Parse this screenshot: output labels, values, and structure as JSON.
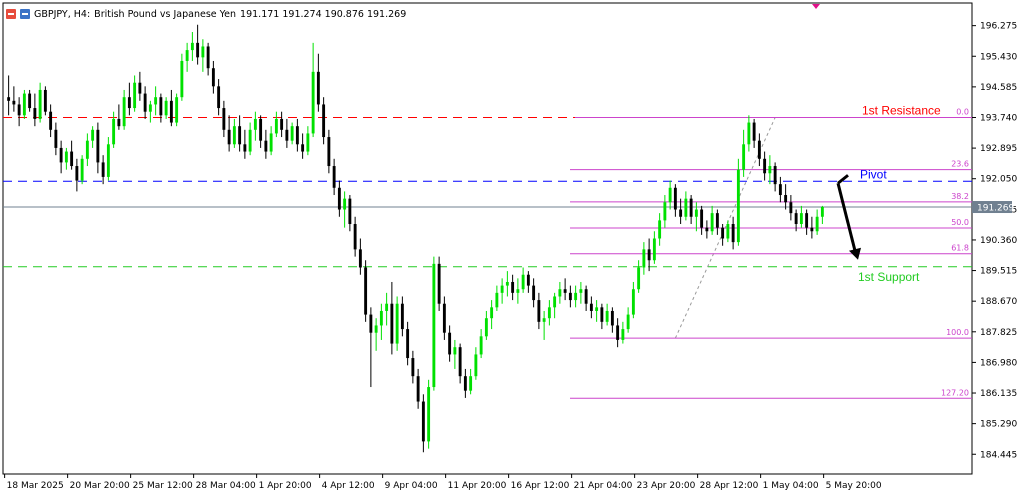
{
  "header": {
    "symbol_timeframe": "GBPJPY, H4:",
    "description": "British Pound vs Japanese Yen",
    "ohlc": "191.171 191.274 190.876 191.269",
    "icons": [
      "chart-properties-icon",
      "indicator-list-icon"
    ]
  },
  "colors": {
    "bull": "#00e000",
    "bear": "#000000",
    "resistance": "#ff0000",
    "pivot": "#0000ff",
    "support": "#22cc22",
    "fib": "#cc44cc",
    "price_line": "#708090",
    "price_badge_bg": "#708090",
    "marker": "#e0128a"
  },
  "chart_data": {
    "type": "candlestick",
    "symbol": "GBPJPY",
    "timeframe": "H4",
    "current_price": "191.269",
    "ylim": [
      183.9,
      196.9
    ],
    "y_ticks": [
      "196.275",
      "195.430",
      "194.585",
      "193.740",
      "192.895",
      "192.050",
      "191.205",
      "190.360",
      "189.515",
      "188.670",
      "187.825",
      "186.980",
      "186.135",
      "185.290",
      "184.445"
    ],
    "x_ticks": [
      "18 Mar 2025",
      "20 Mar 20:00",
      "25 Mar 12:00",
      "28 Mar 04:00",
      "1 Apr 20:00",
      "4 Apr 12:00",
      "9 Apr 04:00",
      "11 Apr 20:00",
      "16 Apr 12:00",
      "21 Apr 04:00",
      "23 Apr 20:00",
      "28 Apr 12:00",
      "1 May 04:00",
      "5 May 20:00"
    ],
    "bar_count": 162,
    "levels": [
      {
        "label": "1st Resistance",
        "value": 193.74,
        "color": "#ff0000"
      },
      {
        "label": "Pivot",
        "value": 191.98,
        "color": "#0000ff"
      },
      {
        "label": "1st Support",
        "value": 189.62,
        "color": "#22cc22"
      }
    ],
    "fibonacci": {
      "high": 193.74,
      "low": 187.65,
      "from_bar": 127,
      "to_bar": 146,
      "levels": [
        {
          "label": "0.0",
          "value": 193.74
        },
        {
          "label": "23.6",
          "value": 192.3
        },
        {
          "label": "38.2",
          "value": 191.41
        },
        {
          "label": "50.0",
          "value": 190.69
        },
        {
          "label": "61.8",
          "value": 189.98
        },
        {
          "label": "100.0",
          "value": 187.65
        },
        {
          "label": "127.20",
          "value": 185.99
        }
      ]
    },
    "candles": [
      [
        194.3,
        194.9,
        193.8,
        194.2
      ],
      [
        194.2,
        194.6,
        193.9,
        194.1
      ],
      [
        194.1,
        194.3,
        193.5,
        193.8
      ],
      [
        193.8,
        194.5,
        193.7,
        194.4
      ],
      [
        194.4,
        194.5,
        193.9,
        194.0
      ],
      [
        194.0,
        194.4,
        193.5,
        193.7
      ],
      [
        193.7,
        194.7,
        193.6,
        194.5
      ],
      [
        194.5,
        194.6,
        193.8,
        193.9
      ],
      [
        193.9,
        194.1,
        193.2,
        193.4
      ],
      [
        193.4,
        193.6,
        192.7,
        192.9
      ],
      [
        192.9,
        193.1,
        192.2,
        192.5
      ],
      [
        192.5,
        192.9,
        192.3,
        192.8
      ],
      [
        192.8,
        193.1,
        192.3,
        192.4
      ],
      [
        192.4,
        192.6,
        191.7,
        192.0
      ],
      [
        192.0,
        192.7,
        191.9,
        192.6
      ],
      [
        192.6,
        193.3,
        192.4,
        193.1
      ],
      [
        193.1,
        193.5,
        192.9,
        193.4
      ],
      [
        193.4,
        193.6,
        192.2,
        192.5
      ],
      [
        192.5,
        192.7,
        191.9,
        192.1
      ],
      [
        192.1,
        193.2,
        192.0,
        193.0
      ],
      [
        193.0,
        193.9,
        192.9,
        193.7
      ],
      [
        193.7,
        194.1,
        193.4,
        193.5
      ],
      [
        193.5,
        194.5,
        193.4,
        194.3
      ],
      [
        194.3,
        194.7,
        193.8,
        194.0
      ],
      [
        194.0,
        194.9,
        193.9,
        194.7
      ],
      [
        194.7,
        195.0,
        194.2,
        194.4
      ],
      [
        194.4,
        194.6,
        193.7,
        193.9
      ],
      [
        193.9,
        194.2,
        193.6,
        194.1
      ],
      [
        194.1,
        194.6,
        193.8,
        194.3
      ],
      [
        194.3,
        194.4,
        193.6,
        193.8
      ],
      [
        193.8,
        194.3,
        193.7,
        194.2
      ],
      [
        194.2,
        194.5,
        193.5,
        193.6
      ],
      [
        193.6,
        194.4,
        193.5,
        194.3
      ],
      [
        194.3,
        195.5,
        194.2,
        195.3
      ],
      [
        195.3,
        195.8,
        195.0,
        195.6
      ],
      [
        195.6,
        196.1,
        195.3,
        195.8
      ],
      [
        195.8,
        196.3,
        195.2,
        195.4
      ],
      [
        195.4,
        195.9,
        195.0,
        195.7
      ],
      [
        195.7,
        195.8,
        194.9,
        195.1
      ],
      [
        195.1,
        195.3,
        194.4,
        194.6
      ],
      [
        194.6,
        194.8,
        193.8,
        194.0
      ],
      [
        194.0,
        194.2,
        193.2,
        193.4
      ],
      [
        193.4,
        193.8,
        192.8,
        193.0
      ],
      [
        193.0,
        193.7,
        192.9,
        193.5
      ],
      [
        193.5,
        193.8,
        192.8,
        193.0
      ],
      [
        193.0,
        193.4,
        192.6,
        192.8
      ],
      [
        192.8,
        193.6,
        192.7,
        193.4
      ],
      [
        193.4,
        193.9,
        193.1,
        193.7
      ],
      [
        193.7,
        193.8,
        192.9,
        193.1
      ],
      [
        193.1,
        193.4,
        192.6,
        192.8
      ],
      [
        192.8,
        193.5,
        192.7,
        193.3
      ],
      [
        193.3,
        193.9,
        193.2,
        193.7
      ],
      [
        193.7,
        193.9,
        193.2,
        193.4
      ],
      [
        193.4,
        193.7,
        192.9,
        193.1
      ],
      [
        193.1,
        193.6,
        193.0,
        193.5
      ],
      [
        193.5,
        193.7,
        192.8,
        193.0
      ],
      [
        193.0,
        193.3,
        192.6,
        192.8
      ],
      [
        192.8,
        193.5,
        192.7,
        193.3
      ],
      [
        193.3,
        195.8,
        193.2,
        195.0
      ],
      [
        195.0,
        195.5,
        193.9,
        194.1
      ],
      [
        194.1,
        194.3,
        193.0,
        193.2
      ],
      [
        193.2,
        193.4,
        192.2,
        192.4
      ],
      [
        192.4,
        192.6,
        191.6,
        191.8
      ],
      [
        191.8,
        192.0,
        191.0,
        191.2
      ],
      [
        191.2,
        191.7,
        190.7,
        191.5
      ],
      [
        191.5,
        191.6,
        190.6,
        190.8
      ],
      [
        190.8,
        191.0,
        189.9,
        190.1
      ],
      [
        190.1,
        190.4,
        189.4,
        189.6
      ],
      [
        189.6,
        189.8,
        188.1,
        188.3
      ],
      [
        188.3,
        188.5,
        186.3,
        187.8
      ],
      [
        187.8,
        188.2,
        187.3,
        188.0
      ],
      [
        188.0,
        188.6,
        187.6,
        188.4
      ],
      [
        188.4,
        188.9,
        188.0,
        188.6
      ],
      [
        188.6,
        189.2,
        187.2,
        187.5
      ],
      [
        187.5,
        188.8,
        187.3,
        188.6
      ],
      [
        188.6,
        188.8,
        187.7,
        187.9
      ],
      [
        187.9,
        188.1,
        186.9,
        187.1
      ],
      [
        187.1,
        187.3,
        186.4,
        186.6
      ],
      [
        186.6,
        186.8,
        185.7,
        185.9
      ],
      [
        185.9,
        186.1,
        184.5,
        184.8
      ],
      [
        184.8,
        186.5,
        184.6,
        186.3
      ],
      [
        186.3,
        189.9,
        186.2,
        189.7
      ],
      [
        189.7,
        189.9,
        188.4,
        188.6
      ],
      [
        188.6,
        188.8,
        187.6,
        187.8
      ],
      [
        187.8,
        188.0,
        187.0,
        187.2
      ],
      [
        187.2,
        187.6,
        186.8,
        187.4
      ],
      [
        187.4,
        187.5,
        186.4,
        186.6
      ],
      [
        186.6,
        186.8,
        186.0,
        186.2
      ],
      [
        186.2,
        186.8,
        186.1,
        186.6
      ],
      [
        186.6,
        187.4,
        186.5,
        187.2
      ],
      [
        187.2,
        187.9,
        187.1,
        187.7
      ],
      [
        187.7,
        188.4,
        187.6,
        188.2
      ],
      [
        188.2,
        188.7,
        187.9,
        188.5
      ],
      [
        188.5,
        189.1,
        188.4,
        188.9
      ],
      [
        188.9,
        189.3,
        188.6,
        189.1
      ],
      [
        189.1,
        189.5,
        188.8,
        189.2
      ],
      [
        189.2,
        189.4,
        188.7,
        188.9
      ],
      [
        188.9,
        189.3,
        188.6,
        189.0
      ],
      [
        189.0,
        189.6,
        188.9,
        189.4
      ],
      [
        189.4,
        189.5,
        188.9,
        189.1
      ],
      [
        189.1,
        189.3,
        188.5,
        188.7
      ],
      [
        188.7,
        188.9,
        187.9,
        188.1
      ],
      [
        188.1,
        188.4,
        187.6,
        188.2
      ],
      [
        188.2,
        188.7,
        188.0,
        188.5
      ],
      [
        188.5,
        188.9,
        188.2,
        188.8
      ],
      [
        188.8,
        189.2,
        188.6,
        189.0
      ],
      [
        189.0,
        189.3,
        188.7,
        188.9
      ],
      [
        188.9,
        189.1,
        188.5,
        188.7
      ],
      [
        188.7,
        189.1,
        188.5,
        188.9
      ],
      [
        188.9,
        189.2,
        188.6,
        189.0
      ],
      [
        189.0,
        189.1,
        188.4,
        188.6
      ],
      [
        188.6,
        188.8,
        188.2,
        188.4
      ],
      [
        188.4,
        188.7,
        188.1,
        188.5
      ],
      [
        188.5,
        188.6,
        187.9,
        188.1
      ],
      [
        188.1,
        188.6,
        188.0,
        188.4
      ],
      [
        188.4,
        188.5,
        187.8,
        188.0
      ],
      [
        188.0,
        188.2,
        187.4,
        187.6
      ],
      [
        187.6,
        188.1,
        187.5,
        187.9
      ],
      [
        187.9,
        188.5,
        187.8,
        188.3
      ],
      [
        188.3,
        189.2,
        188.2,
        189.0
      ],
      [
        189.0,
        189.8,
        188.9,
        189.6
      ],
      [
        189.6,
        190.3,
        189.4,
        190.1
      ],
      [
        190.1,
        190.4,
        189.5,
        189.8
      ],
      [
        189.8,
        190.6,
        189.7,
        190.4
      ],
      [
        190.4,
        191.1,
        190.2,
        190.9
      ],
      [
        190.9,
        191.6,
        190.7,
        191.4
      ],
      [
        191.4,
        192.0,
        191.2,
        191.8
      ],
      [
        191.8,
        191.9,
        191.0,
        191.2
      ],
      [
        191.2,
        191.5,
        190.8,
        191.0
      ],
      [
        191.0,
        191.7,
        190.9,
        191.5
      ],
      [
        191.5,
        191.6,
        190.8,
        191.0
      ],
      [
        191.0,
        191.4,
        190.6,
        191.2
      ],
      [
        191.2,
        191.3,
        190.5,
        190.7
      ],
      [
        190.7,
        190.9,
        190.4,
        190.6
      ],
      [
        190.6,
        191.3,
        190.5,
        191.1
      ],
      [
        191.1,
        191.2,
        190.5,
        190.7
      ],
      [
        190.7,
        190.8,
        190.2,
        190.4
      ],
      [
        190.4,
        190.9,
        190.3,
        190.8
      ],
      [
        190.8,
        191.0,
        190.1,
        190.3
      ],
      [
        190.3,
        192.6,
        190.2,
        192.3
      ],
      [
        192.3,
        193.4,
        192.1,
        193.0
      ],
      [
        193.0,
        193.8,
        192.8,
        193.6
      ],
      [
        193.6,
        193.7,
        192.9,
        193.1
      ],
      [
        193.1,
        193.3,
        192.4,
        192.6
      ],
      [
        192.6,
        192.8,
        192.0,
        192.2
      ],
      [
        192.2,
        192.7,
        191.9,
        192.4
      ],
      [
        192.4,
        192.5,
        191.7,
        191.9
      ],
      [
        191.9,
        192.1,
        191.4,
        191.6
      ],
      [
        191.6,
        191.9,
        191.2,
        191.4
      ],
      [
        191.4,
        191.6,
        190.9,
        191.1
      ],
      [
        191.1,
        191.2,
        190.6,
        190.8
      ],
      [
        190.8,
        191.3,
        190.7,
        191.1
      ],
      [
        191.1,
        191.2,
        190.5,
        190.7
      ],
      [
        190.7,
        191.0,
        190.4,
        190.6
      ],
      [
        190.6,
        191.2,
        190.5,
        191.0
      ],
      [
        191.0,
        191.3,
        190.8,
        191.27
      ]
    ]
  }
}
